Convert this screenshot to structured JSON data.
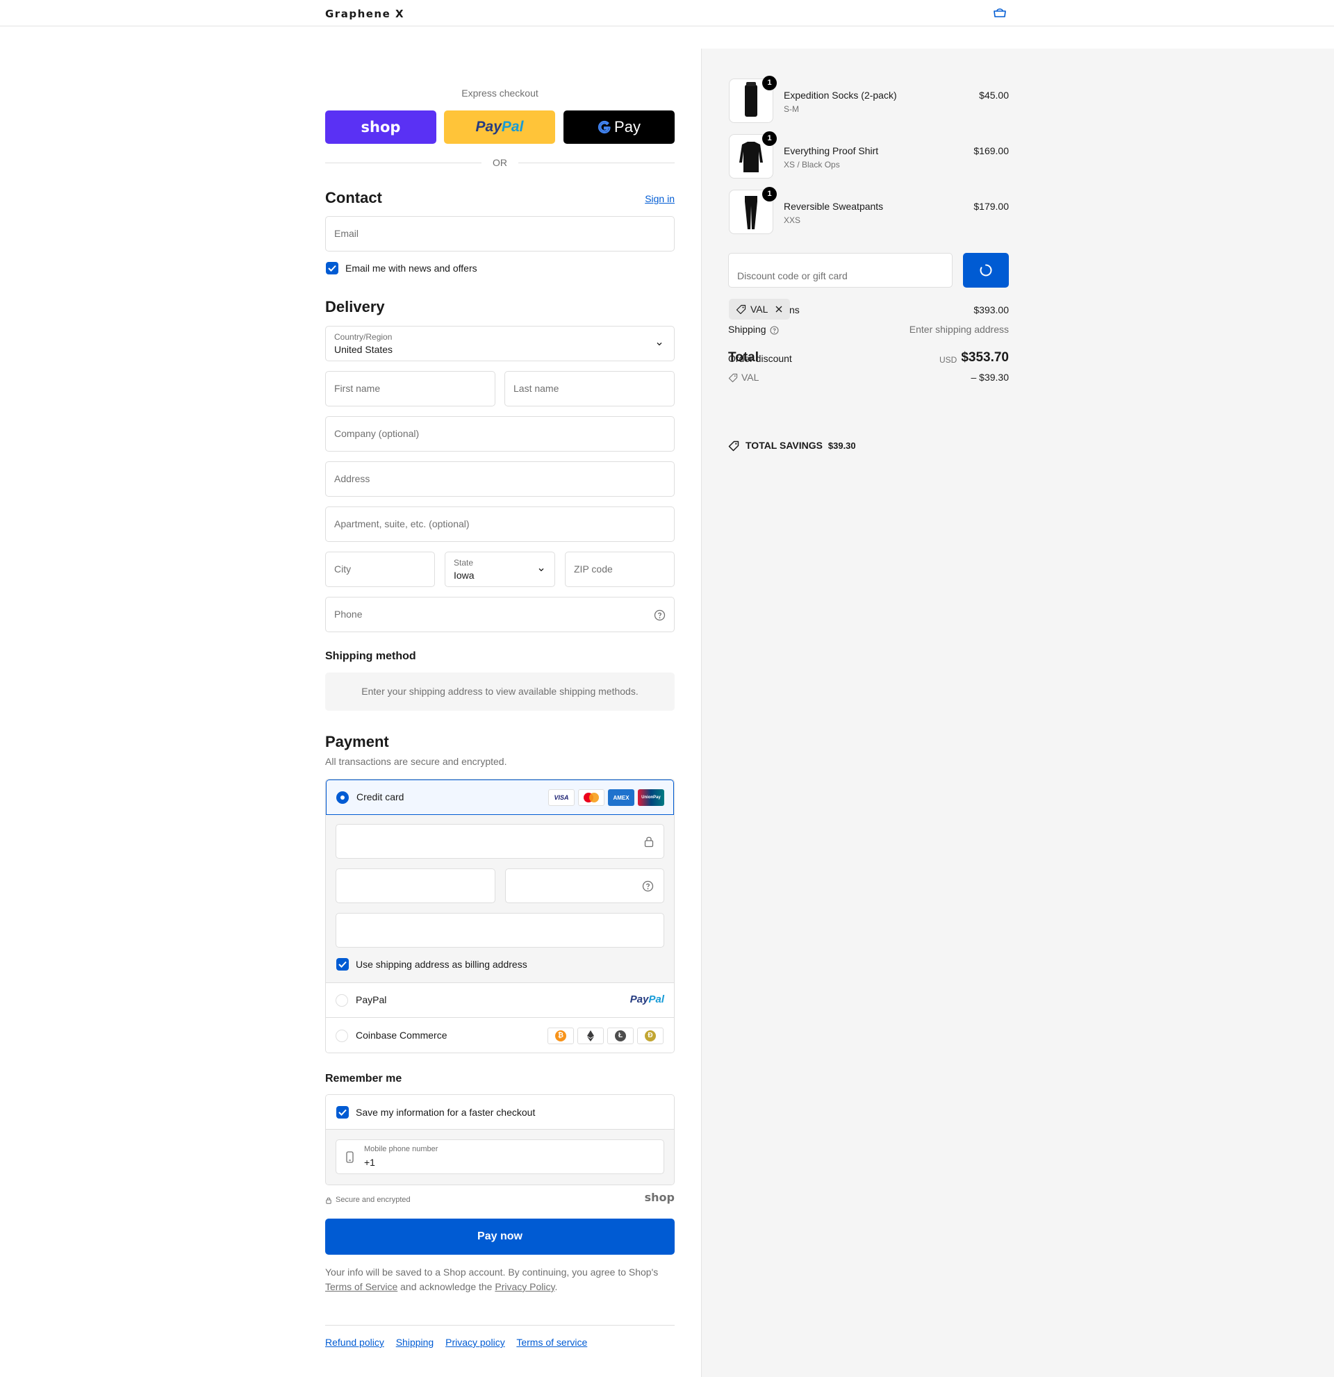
{
  "header": {
    "logo": "Graphene X",
    "cart_icon": "bag-icon"
  },
  "express": {
    "label": "Express checkout",
    "shop_label": "shop",
    "paypal_pay": "Pay",
    "paypal_pal": "Pal",
    "gpay_label": "Pay",
    "or_label": "OR"
  },
  "contact": {
    "title": "Contact",
    "signin": "Sign in",
    "email_placeholder": "Email",
    "newsletter_label": "Email me with news and offers",
    "newsletter_checked": true
  },
  "delivery": {
    "title": "Delivery",
    "country_label": "Country/Region",
    "country_value": "United States",
    "first_name_placeholder": "First name",
    "last_name_placeholder": "Last name",
    "company_placeholder": "Company (optional)",
    "address_placeholder": "Address",
    "apartment_placeholder": "Apartment, suite, etc. (optional)",
    "city_placeholder": "City",
    "state_label": "State",
    "state_value": "Iowa",
    "zip_placeholder": "ZIP code",
    "phone_placeholder": "Phone"
  },
  "shipping_method": {
    "title": "Shipping method",
    "info": "Enter your shipping address to view available shipping methods."
  },
  "payment": {
    "title": "Payment",
    "subtitle": "All transactions are secure and encrypted.",
    "credit_card_label": "Credit card",
    "card_brands": [
      "VISA",
      "mastercard",
      "AMEX",
      "UnionPay"
    ],
    "billing_label": "Use shipping address as billing address",
    "billing_checked": true,
    "paypal_label": "PayPal",
    "paypal_logo_pay": "Pay",
    "paypal_logo_pal": "Pal",
    "coinbase_label": "Coinbase Commerce",
    "crypto_icons": [
      "bitcoin-icon",
      "ethereum-icon",
      "litecoin-icon",
      "dogecoin-icon"
    ],
    "colors": {
      "accent": "#005bd3",
      "selected_bg": "#f2f7ff"
    }
  },
  "remember": {
    "title": "Remember me",
    "save_label": "Save my information for a faster checkout",
    "save_checked": true,
    "mobile_label": "Mobile phone number",
    "mobile_value": "+1",
    "secure_label": "Secure and encrypted",
    "shop_logo": "shop"
  },
  "pay_now": "Pay now",
  "legal": {
    "text1": "Your info will be saved to a Shop account. By continuing, you agree to Shop's",
    "terms": "Terms of Service",
    "text2": "and acknowledge the",
    "privacy": "Privacy Policy",
    "text3": "."
  },
  "footer": {
    "links": [
      "Refund policy",
      "Shipping",
      "Privacy policy",
      "Terms of service"
    ]
  },
  "order": {
    "items": [
      {
        "name": "Expedition Socks (2-pack)",
        "variant": "S-M",
        "price": "$45.00",
        "qty": "1"
      },
      {
        "name": "Everything Proof Shirt",
        "variant": "XS / Black Ops",
        "price": "$169.00",
        "qty": "1"
      },
      {
        "name": "Reversible Sweatpants",
        "variant": "XXS",
        "price": "$179.00",
        "qty": "1"
      }
    ],
    "discount_placeholder": "Discount code or gift card",
    "applied_code": "VAL",
    "subtotal_label_fragment": "ns",
    "subtotal_value": "$393.00",
    "shipping_label": "Shipping",
    "shipping_value": "Enter shipping address",
    "total_label": "Total",
    "order_discount_label": "Order discount",
    "currency": "USD",
    "total_value": "$353.70",
    "discount_code": "VAL",
    "discount_value": "– $39.30",
    "savings_label": "TOTAL SAVINGS",
    "savings_value": "$39.30"
  }
}
